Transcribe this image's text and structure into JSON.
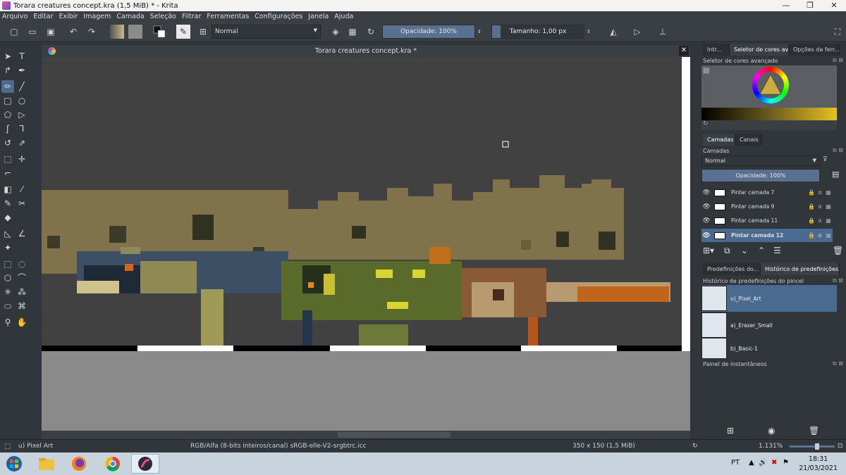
{
  "window": {
    "title": "Torara creatures concept.kra (1,5 MiB)  * - Krita",
    "controls": [
      "—",
      "❐",
      "✕"
    ]
  },
  "menu": [
    "Arquivo",
    "Editar",
    "Exibir",
    "Imagem",
    "Camada",
    "Seleção",
    "Filtrar",
    "Ferramentas",
    "Configurações",
    "Janela",
    "Ajuda"
  ],
  "toolbar": {
    "blend_mode": "Normal",
    "opacity": "Opacidade: 100%",
    "size": "Tamanho: 1,00 px"
  },
  "canvas": {
    "title": "Torara creatures concept.kra *",
    "close": "✕"
  },
  "dock": {
    "top_tabs": [
      "Intr...",
      "Seletor de cores av...",
      "Opções da ferr..."
    ],
    "color_title": "Seletor de cores avançado",
    "layer_tabs": [
      "Camadas",
      "Canais"
    ],
    "layers_title": "Camadas",
    "layer_blend": "Normal",
    "layer_opacity": "Opacidade:  100%",
    "layers": [
      {
        "name": "Pintar camada 7"
      },
      {
        "name": "Pintar camada 9"
      },
      {
        "name": "Pintar camada 11"
      },
      {
        "name": "Pintar camada 12"
      }
    ],
    "preset_tabs": [
      "Predefinições do...",
      "Histórico de predefinições do ..."
    ],
    "preset_title": "Histórico de predefinições do pincel",
    "presets": [
      {
        "name": "u)_Pixel_Art"
      },
      {
        "name": "a)_Eraser_Small"
      },
      {
        "name": "b)_Basic-1"
      }
    ],
    "snapshot_title": "Painel de instantâneos"
  },
  "status": {
    "brush": "u) Pixel Art",
    "color_space": "RGB/Alfa (8-bits inteiros/canal)  sRGB-elle-V2-srgbtrc.icc",
    "dimensions": "350 x 150 (1,5 MiB)",
    "zoom": "1.131%"
  },
  "taskbar": {
    "lang": "PT",
    "time": "18:31",
    "date": "21/03/2021"
  },
  "colors": {
    "accent": "#5a7090",
    "selection": "#4a6a8f",
    "canvas_bg": "#414141",
    "ground": "#80724a"
  }
}
